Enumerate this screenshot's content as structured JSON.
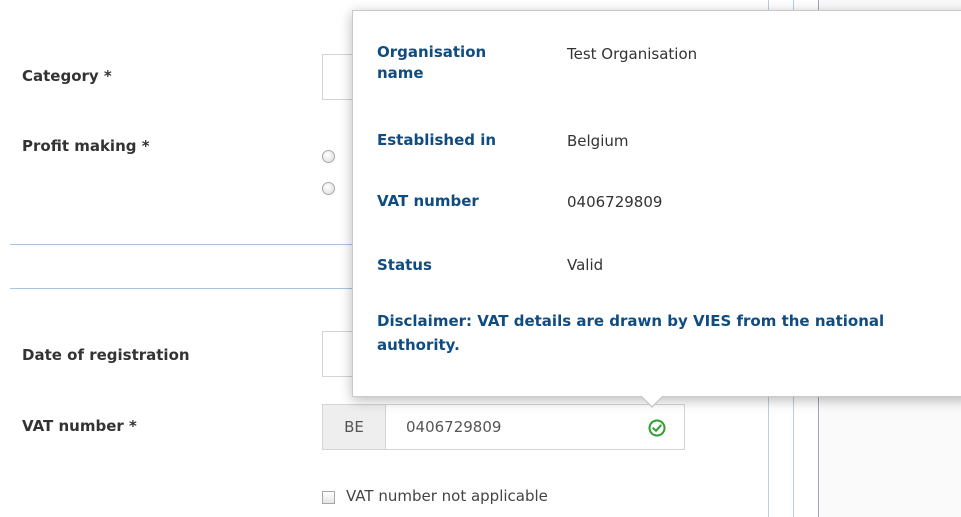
{
  "form": {
    "category_label": "Category *",
    "profit_making_label": "Profit making *",
    "date_of_registration_label": "Date of registration",
    "vat_number_label": "VAT number *",
    "vat_prefix": "BE",
    "vat_value": "0406729809",
    "vat_not_applicable_label": "VAT number not applicable"
  },
  "popover": {
    "rows": [
      {
        "label": "Organisation name",
        "value": "Test Organisation"
      },
      {
        "label": "Established in",
        "value": "Belgium"
      },
      {
        "label": "VAT number",
        "value": "0406729809"
      },
      {
        "label": "Status",
        "value": "Valid"
      }
    ],
    "disclaimer": "Disclaimer: VAT details are drawn by VIES from the national authority."
  },
  "icons": {
    "vat_valid": "check-circle-icon"
  },
  "colors": {
    "label_blue": "#0e4c82",
    "valid_green": "#2e9e2e",
    "divider_blue": "#a9c4de"
  }
}
